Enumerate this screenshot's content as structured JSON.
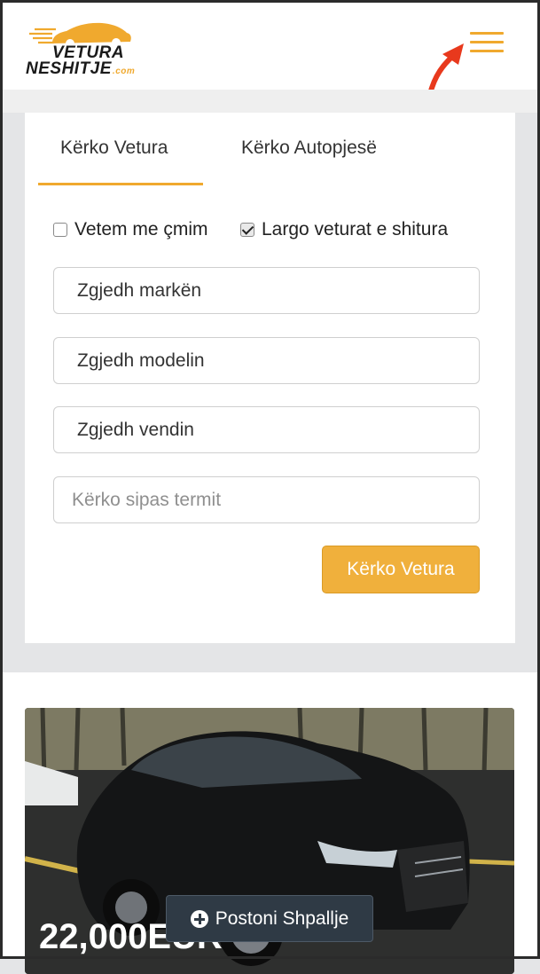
{
  "brand": {
    "line1": "VETURA",
    "line2": "NESHITJE",
    "domain": ".com"
  },
  "tabs": [
    {
      "label": "Kërko Vetura"
    },
    {
      "label": "Kërko Autopjesë"
    }
  ],
  "filters": {
    "only_price": {
      "label": "Vetem me çmim",
      "checked": false
    },
    "hide_sold": {
      "label": "Largo veturat e shitura",
      "checked": true
    }
  },
  "selects": {
    "brand": "Zgjedh markën",
    "model": "Zgjedh modelin",
    "country": "Zgjedh vendin"
  },
  "search": {
    "placeholder": "Kërko sipas termit"
  },
  "buttons": {
    "search_label": "Kërko Vetura",
    "post_label": "Postoni Shpallje"
  },
  "listing": {
    "price": "22,000EUR"
  },
  "colors": {
    "accent": "#f0a92e",
    "dark_button": "#2f3a45",
    "arrow": "#e8391d"
  }
}
